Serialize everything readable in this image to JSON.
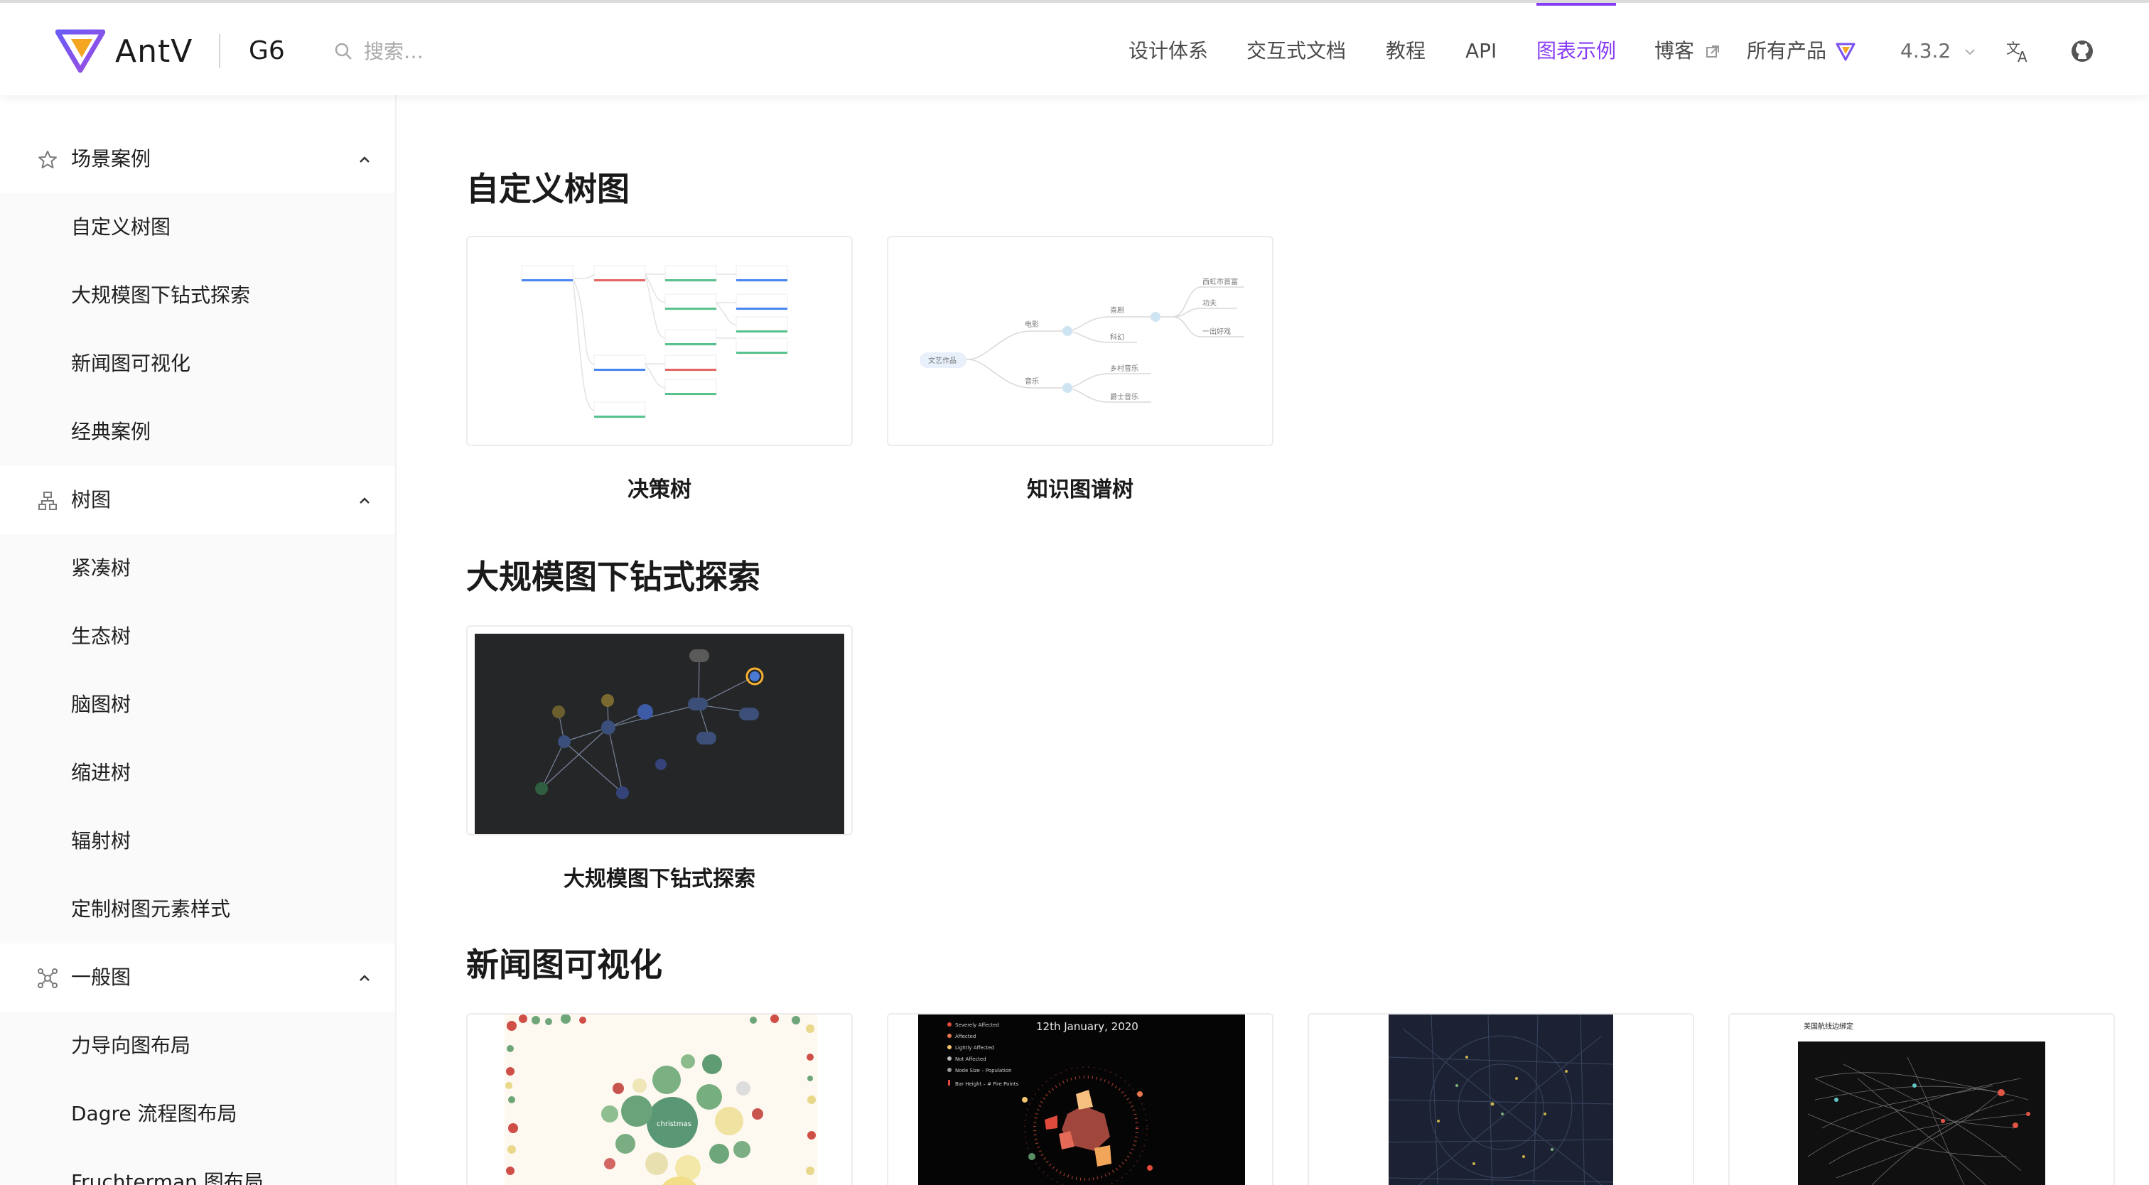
{
  "header": {
    "logo_text": "AntV",
    "product_name": "G6",
    "search_placeholder": "搜索…",
    "nav": [
      {
        "label": "设计体系"
      },
      {
        "label": "交互式文档"
      },
      {
        "label": "教程"
      },
      {
        "label": "API"
      },
      {
        "label": "图表示例",
        "active": true
      },
      {
        "label": "博客",
        "icon": "external-link-icon"
      },
      {
        "label": "所有产品",
        "icon": "antv-logo-icon"
      }
    ],
    "version": "4.3.2",
    "icons": [
      "language-icon",
      "github-icon"
    ],
    "accent_color": "#873bf4"
  },
  "sidebar": {
    "groups": [
      {
        "label": "场景案例",
        "icon": "star-icon",
        "items": [
          "自定义树图",
          "大规模图下钻式探索",
          "新闻图可视化",
          "经典案例"
        ]
      },
      {
        "label": "树图",
        "icon": "tree-icon",
        "items": [
          "紧凑树",
          "生态树",
          "脑图树",
          "缩进树",
          "辐射树",
          "定制树图元素样式"
        ]
      },
      {
        "label": "一般图",
        "icon": "graph-icon",
        "items": [
          "力导向图布局",
          "Dagre 流程图布局",
          "Fruchterman 图布局"
        ]
      }
    ]
  },
  "main": {
    "sections": [
      {
        "title": "自定义树图",
        "cards": [
          "决策树",
          "知识图谱树"
        ]
      },
      {
        "title": "大规模图下钻式探索",
        "cards": [
          "大规模图下钻式探索"
        ]
      },
      {
        "title": "新闻图可视化",
        "cards": [
          "",
          "",
          "",
          ""
        ]
      }
    ],
    "thumb_text": {
      "kg_root": "文艺作品",
      "kg_movie": "电影",
      "kg_music": "音乐",
      "kg_n1": "喜剧",
      "kg_n2": "科幻",
      "kg_n3": "乡村音乐",
      "kg_n4": "爵士音乐",
      "kg_n5": "西虹市首富",
      "kg_n6": "功夫",
      "kg_n7": "一出好戏",
      "news_date": "12th January, 2020",
      "news_legend": [
        "Severely Affected",
        "Affected",
        "Lightly Affected",
        "Not Affected",
        "Node Size – Population",
        "Bar Height – # Fire Points"
      ],
      "xmas_center": "christmas",
      "flight_title": "美国航线边绑定"
    }
  }
}
